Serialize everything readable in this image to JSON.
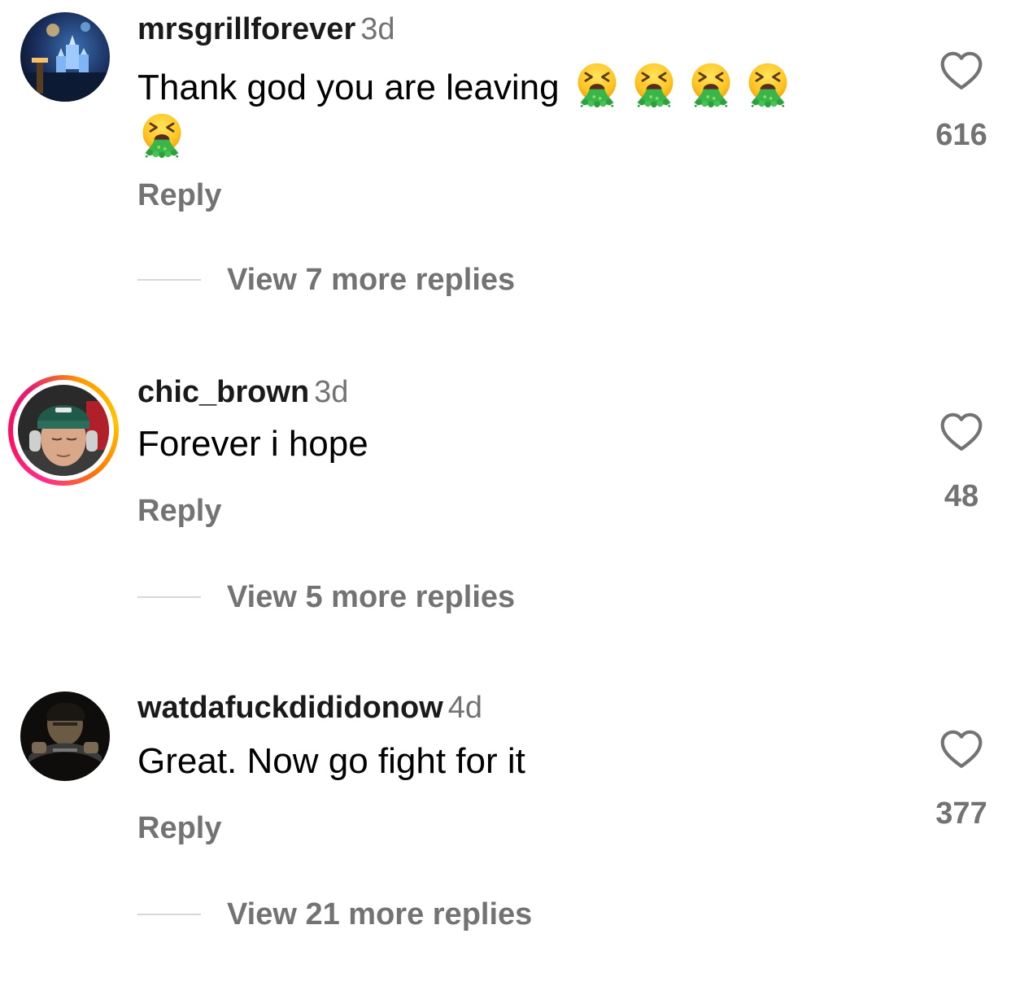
{
  "comments": [
    {
      "username": "mrsgrillforever",
      "time": "3d",
      "text": "Thank god you are leaving",
      "emoji_name": "vomiting-face-emoji",
      "emoji_count": 5,
      "reply_label": "Reply",
      "view_replies_label": "View 7 more replies",
      "like_count": "616",
      "avatar": "avatar-castle-fireworks",
      "story_ring": false
    },
    {
      "username": "chic_brown",
      "time": "3d",
      "text": "Forever i hope",
      "reply_label": "Reply",
      "view_replies_label": "View 5 more replies",
      "like_count": "48",
      "avatar": "avatar-man-beanie-headphones",
      "story_ring": true
    },
    {
      "username": "watdafuckdididonow",
      "time": "4d",
      "text": "Great. Now go fight for it",
      "reply_label": "Reply",
      "view_replies_label": "View 21 more replies",
      "like_count": "377",
      "avatar": "avatar-person-driving",
      "story_ring": false
    }
  ],
  "colors": {
    "secondary_text": "#737373",
    "divider": "#d7d7d7",
    "story_ring_pink": "#ff2d8e",
    "story_ring_orange": "#ff9b00"
  },
  "icons": {
    "like": "heart-outline-icon"
  }
}
